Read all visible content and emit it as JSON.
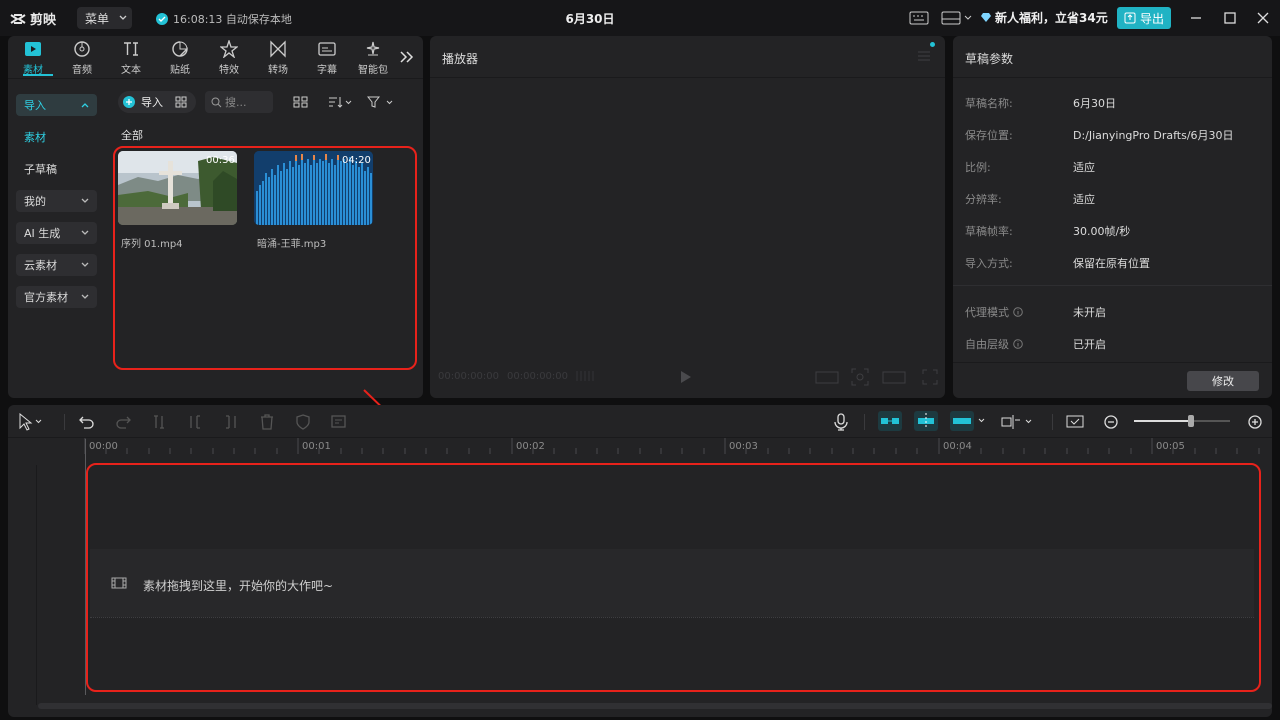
{
  "app": {
    "name": "剪映",
    "menu_label": "菜单",
    "autosave": "16:08:13 自动保存本地",
    "doc_title": "6月30日",
    "promo": "新人福利，立省34元",
    "export_label": "导出"
  },
  "media_tabs": [
    {
      "label": "素材",
      "icon": "media-play-icon"
    },
    {
      "label": "音频",
      "icon": "audio-disc-icon"
    },
    {
      "label": "文本",
      "icon": "text-ti-icon"
    },
    {
      "label": "贴纸",
      "icon": "sticker-icon"
    },
    {
      "label": "特效",
      "icon": "effects-star-icon"
    },
    {
      "label": "转场",
      "icon": "transition-icon"
    },
    {
      "label": "字幕",
      "icon": "subtitle-icon"
    },
    {
      "label": "智能包",
      "icon": "smart-icon"
    }
  ],
  "sidebar": {
    "import": "导入",
    "material": "素材",
    "sub_draft": "子草稿",
    "mine": "我的",
    "ai": "AI 生成",
    "cloud": "云素材",
    "official": "官方素材"
  },
  "media": {
    "import_btn": "导入",
    "search_placeholder": "搜...",
    "all_label": "全部",
    "files": [
      {
        "name": "序列 01.mp4",
        "duration": "00:36"
      },
      {
        "name": "暗涌-王菲.mp3",
        "duration": "04:20"
      }
    ]
  },
  "player": {
    "title": "播放器",
    "time_current": "00:00:00:00",
    "time_total": "00:00:00:00"
  },
  "params": {
    "title": "草稿参数",
    "rows": [
      {
        "key": "草稿名称:",
        "value": "6月30日"
      },
      {
        "key": "保存位置:",
        "value": "D:/JianyingPro Drafts/6月30日"
      },
      {
        "key": "比例:",
        "value": "适应"
      },
      {
        "key": "分辨率:",
        "value": "适应"
      },
      {
        "key": "草稿帧率:",
        "value": "30.00帧/秒"
      },
      {
        "key": "导入方式:",
        "value": "保留在原有位置"
      },
      {
        "key": "代理模式",
        "value": "未开启"
      },
      {
        "key": "自由层级",
        "value": "已开启"
      }
    ],
    "modify_btn": "修改"
  },
  "timeline": {
    "ruler": [
      "00:00",
      "00:01",
      "00:02",
      "00:03",
      "00:04",
      "00:05"
    ],
    "drop_hint": "素材拖拽到这里，开始你的大作吧~"
  },
  "colors": {
    "accent": "#23c2d6",
    "annotation": "#e8221b"
  }
}
